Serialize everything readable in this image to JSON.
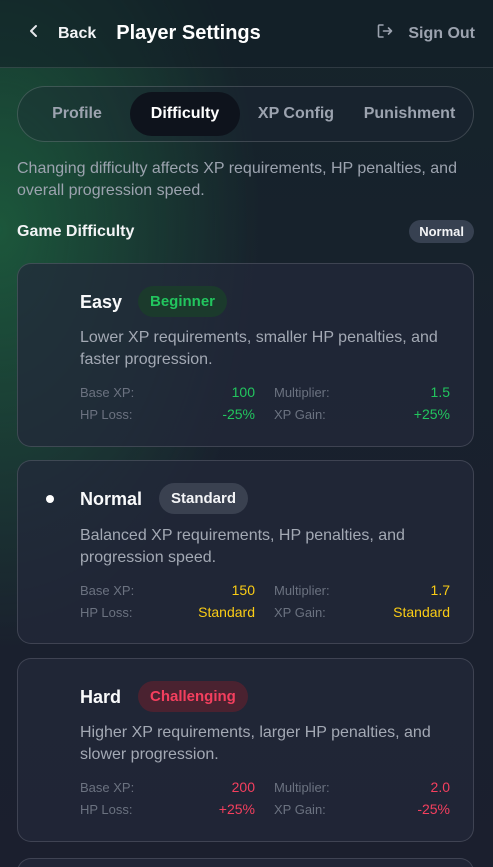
{
  "header": {
    "back_label": "Back",
    "title": "Player Settings",
    "signout_label": "Sign Out"
  },
  "tabs": [
    {
      "label": "Profile",
      "active": false
    },
    {
      "label": "Difficulty",
      "active": true
    },
    {
      "label": "XP Config",
      "active": false
    },
    {
      "label": "Punishment",
      "active": false
    }
  ],
  "description": "Changing difficulty affects XP requirements, HP penalties, and overall progression speed.",
  "section": {
    "title": "Game Difficulty",
    "current": "Normal"
  },
  "stat_labels": {
    "base_xp": "Base XP:",
    "hp_loss": "HP Loss:",
    "multiplier": "Multiplier:",
    "xp_gain": "XP Gain:"
  },
  "difficulties": [
    {
      "name": "Easy",
      "badge": "Beginner",
      "selected": false,
      "description": "Lower XP requirements, smaller HP penalties, and faster progression.",
      "base_xp": "100",
      "hp_loss": "-25%",
      "multiplier": "1.5",
      "xp_gain": "+25%",
      "accent": "#22c55e",
      "badge_bg": "#1b3a2c"
    },
    {
      "name": "Normal",
      "badge": "Standard",
      "selected": true,
      "description": "Balanced XP requirements, HP penalties, and progression speed.",
      "base_xp": "150",
      "hp_loss": "Standard",
      "multiplier": "1.7",
      "xp_gain": "Standard",
      "accent": "#facc15",
      "badge_bg": "#3a4150",
      "badge_color": "#f3f4f6"
    },
    {
      "name": "Hard",
      "badge": "Challenging",
      "selected": false,
      "description": "Higher XP requirements, larger HP penalties, and slower progression.",
      "base_xp": "200",
      "hp_loss": "+25%",
      "multiplier": "2.0",
      "xp_gain": "-25%",
      "accent": "#f43f5e",
      "badge_bg": "#4a2230"
    }
  ]
}
